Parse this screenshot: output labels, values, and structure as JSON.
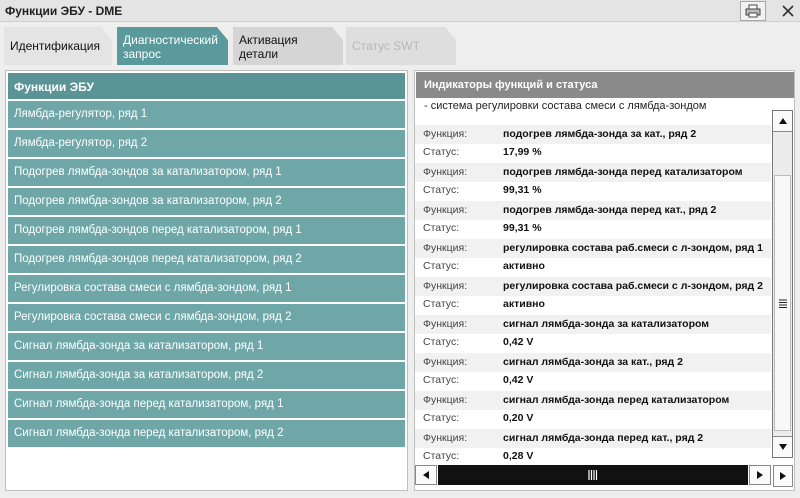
{
  "window": {
    "title": "Функции ЭБУ - DME",
    "print_icon": "printer-icon",
    "close_icon": "close-icon"
  },
  "tabs": [
    {
      "label": "Идентификация",
      "state": "normal"
    },
    {
      "label": "Диагностический запрос",
      "state": "active"
    },
    {
      "label": "Активация детали",
      "state": "normal"
    },
    {
      "label": "Статус SWT",
      "state": "disabled"
    }
  ],
  "left_panel": {
    "header": "Функции ЭБУ",
    "items": [
      "Лямбда-регулятор, ряд 1",
      "Лямбда-регулятор, ряд 2",
      "Подогрев лямбда-зондов за катализатором, ряд 1",
      "Подогрев лямбда-зондов за катализатором, ряд 2",
      "Подогрев лямбда-зондов перед катализатором, ряд 1",
      "Подогрев лямбда-зондов перед катализатором, ряд 2",
      "Регулировка состава смеси с лямбда-зондом, ряд 1",
      "Регулировка состава смеси с лямбда-зондом, ряд 2",
      "Сигнал лямбда-зонда за катализатором, ряд 1",
      "Сигнал лямбда-зонда за катализатором, ряд 2",
      "Сигнал лямбда-зонда перед катализатором, ряд 1",
      "Сигнал лямбда-зонда перед катализатором, ряд 2"
    ]
  },
  "right_panel": {
    "header": "Индикаторы функций и статуса",
    "section_title": "- система регулировки состава смеси с лямбда-зондом",
    "function_label": "Функция:",
    "status_label": "Статус:",
    "entries": [
      {
        "function": "подогрев лямбда-зонда за кат., ряд 2",
        "status": "17,99 %"
      },
      {
        "function": "подогрев лямбда-зонда перед катализатором",
        "status": "99,31 %"
      },
      {
        "function": "подогрев лямбда-зонда перед кат., ряд 2",
        "status": "99,31 %"
      },
      {
        "function": "регулировка состава раб.смеси с л-зондом, ряд 1",
        "status": "активно"
      },
      {
        "function": "регулировка состава раб.смеси с л-зондом, ряд 2",
        "status": "активно"
      },
      {
        "function": "сигнал лямбда-зонда за катализатором",
        "status": "0,42 V"
      },
      {
        "function": "сигнал лямбда-зонда за кат., ряд 2",
        "status": "0,42 V"
      },
      {
        "function": "сигнал лямбда-зонда перед катализатором",
        "status": "0,20 V"
      },
      {
        "function": "сигнал лямбда-зонда перед кат., ряд 2",
        "status": "0,28 V"
      }
    ]
  },
  "scrollbars": {
    "up_icon": "arrow-up-icon",
    "down_icon": "arrow-down-icon",
    "left_icon": "arrow-left-icon",
    "right_icon": "arrow-right-icon",
    "grip_icon": "grip-icon"
  },
  "colors": {
    "active_tab": "#5b9a9c",
    "list_item": "#6fa7a8",
    "list_header": "#5a9496",
    "right_header": "#8a8a8a"
  }
}
